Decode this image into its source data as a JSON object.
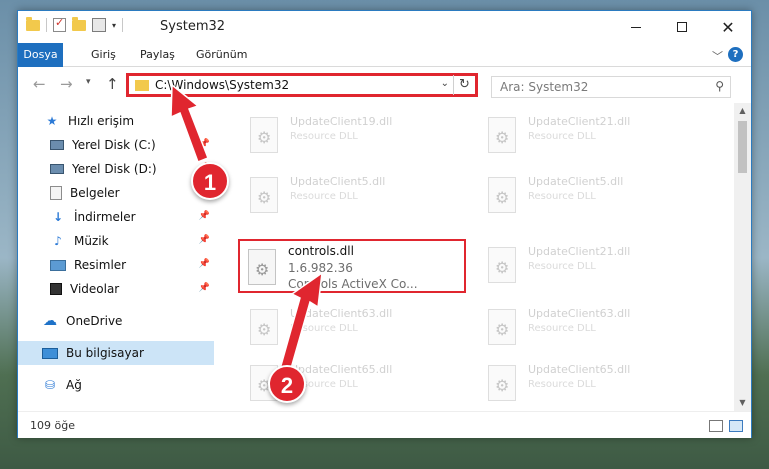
{
  "window": {
    "title": "System32",
    "controls": {
      "minimize": "─",
      "maximize": "☐",
      "close": "✕"
    }
  },
  "ribbon": {
    "tabs": [
      "Dosya",
      "Giriş",
      "Paylaş",
      "Görünüm"
    ],
    "active_tab": "Dosya",
    "help": "?"
  },
  "navigation": {
    "back": "←",
    "forward": "→",
    "recent": "▾",
    "up": "↑",
    "address": "C:\\Windows\\System32",
    "search_placeholder": "Ara: System32"
  },
  "sidebar": {
    "items": [
      {
        "label": "Hızlı erişim",
        "icon": "star-icon"
      },
      {
        "label": "Yerel Disk (C:)",
        "icon": "drive-icon",
        "pinned": true
      },
      {
        "label": "Yerel Disk (D:)",
        "icon": "drive-icon",
        "pinned": true
      },
      {
        "label": "Belgeler",
        "icon": "document-icon",
        "pinned": true
      },
      {
        "label": "İndirmeler",
        "icon": "download-icon",
        "pinned": true
      },
      {
        "label": "Müzik",
        "icon": "music-icon",
        "pinned": true
      },
      {
        "label": "Resimler",
        "icon": "pictures-icon",
        "pinned": true
      },
      {
        "label": "Videolar",
        "icon": "videos-icon",
        "pinned": true
      },
      {
        "label": "OneDrive",
        "icon": "cloud-icon"
      },
      {
        "label": "Bu bilgisayar",
        "icon": "computer-icon",
        "selected": true
      },
      {
        "label": "Ağ",
        "icon": "network-icon"
      }
    ]
  },
  "files": [
    {
      "name": "UpdateClient19.dll",
      "desc": "Resource DLL"
    },
    {
      "name": "UpdateClient21.dll",
      "desc": "Resource DLL"
    },
    {
      "name": "UpdateClient5.dll",
      "desc": "Resource DLL"
    },
    {
      "name": "UpdateClient5.dll",
      "desc": "Resource DLL"
    },
    {
      "name": "controls.dll",
      "version": "1.6.982.36",
      "desc": "Controls ActiveX Co...",
      "highlighted": true
    },
    {
      "name": "UpdateClient21.dll",
      "desc": "Resource DLL"
    },
    {
      "name": "UpdateClient63.dll",
      "desc": "Resource DLL"
    },
    {
      "name": "UpdateClient63.dll",
      "desc": "Resource DLL"
    },
    {
      "name": "UpdateClient65.dll",
      "desc": "Resource DLL"
    },
    {
      "name": "UpdateClient65.dll",
      "desc": "Resource DLL"
    }
  ],
  "status": {
    "item_count": "109 öğe"
  },
  "annotations": {
    "step1": "1",
    "step2": "2",
    "color": "#e0262f"
  }
}
